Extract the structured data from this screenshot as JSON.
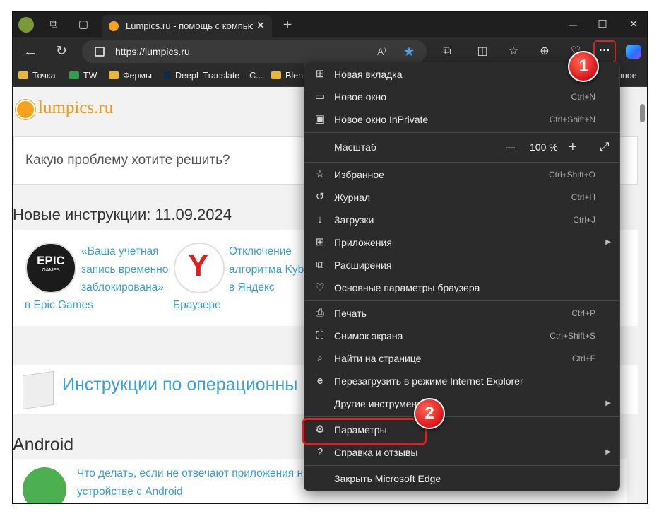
{
  "tab": {
    "title": "Lumpics.ru - помощь с компьюте",
    "close": "✕",
    "new_tab": "+"
  },
  "window_controls": {
    "minimize": "—",
    "maximize": "☐",
    "close": "✕"
  },
  "address": {
    "url": "https://lumpics.ru",
    "read_aloud": "A⁾"
  },
  "bookmarks": [
    "Точка",
    "TW",
    "Фермы",
    "DeepL Translate – C...",
    "Blen",
    "нное"
  ],
  "page": {
    "logo": "lumpics.ru",
    "search_placeholder": "Какую проблему хотите решить?",
    "news_heading": "Новые инструкции: 11.09.2024",
    "articles": [
      {
        "title": "«Ваша учетная запись временно заблокирована» в Epic Games",
        "lines": [
          "«Ваша учетная",
          "запись временно",
          "заблокирована»",
          "в Epic Games"
        ],
        "icon": "epic-games-logo",
        "logo_text": [
          "EPIC",
          "GAMES"
        ]
      },
      {
        "title": "Отключение алгоритма Kyb в Яндекс Браузере",
        "lines": [
          "Отключение",
          "алгоритма Kyb",
          "в Яндекс",
          "Браузере"
        ],
        "icon": "yandex-browser-logo"
      }
    ],
    "os_section": {
      "title": "Инструкции по операционны"
    },
    "android_heading": "Android",
    "android_article": {
      "lines": [
        "Что делать, если не отвечают приложения н",
        "устройстве с Android"
      ]
    }
  },
  "menu": {
    "items": [
      {
        "icon": "new-tab-icon",
        "glyph": "⊞",
        "label": "Новая вкладка",
        "shortcut": ""
      },
      {
        "icon": "new-window-icon",
        "glyph": "▭",
        "label": "Новое окно",
        "shortcut": "Ctrl+N"
      },
      {
        "icon": "inprivate-icon",
        "glyph": "▣",
        "label": "Новое окно InPrivate",
        "shortcut": "Ctrl+Shift+N"
      },
      {
        "icon": "favorites-icon",
        "glyph": "☆",
        "label": "Избранное",
        "shortcut": "Ctrl+Shift+O"
      },
      {
        "icon": "history-icon",
        "glyph": "↺",
        "label": "Журнал",
        "shortcut": "Ctrl+H"
      },
      {
        "icon": "downloads-icon",
        "glyph": "↓",
        "label": "Загрузки",
        "shortcut": "Ctrl+J"
      },
      {
        "icon": "apps-icon",
        "glyph": "⊞",
        "label": "Приложения",
        "shortcut": "",
        "submenu": true
      },
      {
        "icon": "extensions-icon",
        "glyph": "⧉",
        "label": "Расширения",
        "shortcut": ""
      },
      {
        "icon": "browser-essentials-icon",
        "glyph": "♡",
        "label": "Основные параметры браузера",
        "shortcut": ""
      },
      {
        "icon": "print-icon",
        "glyph": "⎙",
        "label": "Печать",
        "shortcut": "Ctrl+P"
      },
      {
        "icon": "screenshot-icon",
        "glyph": "⛶",
        "label": "Снимок экрана",
        "shortcut": "Ctrl+Shift+S"
      },
      {
        "icon": "find-icon",
        "glyph": "⌕",
        "label": "Найти на странице",
        "shortcut": "Ctrl+F"
      },
      {
        "icon": "ie-mode-icon",
        "glyph": "e",
        "label": "Перезагрузить в режиме Internet Explorer",
        "shortcut": ""
      },
      {
        "icon": "",
        "glyph": "",
        "label": "Другие инструменты",
        "shortcut": "",
        "submenu": true
      },
      {
        "icon": "settings-icon",
        "glyph": "⚙",
        "label": "Параметры",
        "shortcut": ""
      },
      {
        "icon": "help-icon",
        "glyph": "?",
        "label": "Справка и отзывы",
        "shortcut": "",
        "submenu": true
      },
      {
        "icon": "",
        "glyph": "",
        "label": "Закрыть Microsoft Edge",
        "shortcut": ""
      }
    ],
    "zoom": {
      "label": "Масштаб",
      "value": "100 %",
      "minus": "—",
      "plus": "+",
      "fullscreen": "⤢"
    }
  },
  "annotations": {
    "badge1": "1",
    "badge2": "2"
  },
  "colors": {
    "accent_orange": "#f29a14",
    "link_blue": "#3aa0d6",
    "annotation_red": "#e02020"
  }
}
